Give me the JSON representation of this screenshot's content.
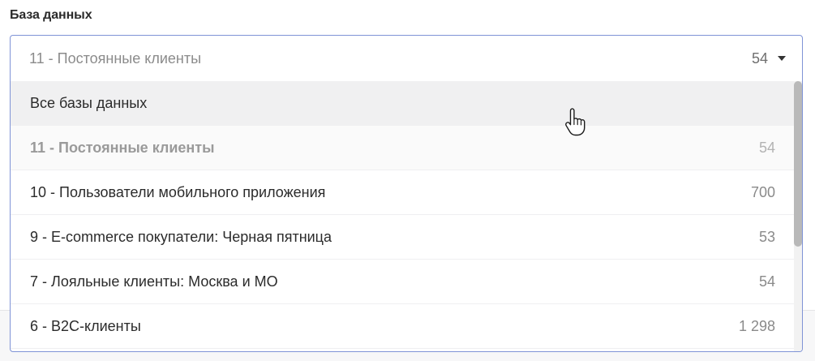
{
  "field": {
    "label": "База данных",
    "selected_value": "11 - Постоянные клиенты",
    "selected_count": "54"
  },
  "dropdown": {
    "options": [
      {
        "label": "Все базы данных",
        "count": "",
        "state": "hovered"
      },
      {
        "label": "11 - Постоянные клиенты",
        "count": "54",
        "state": "selected"
      },
      {
        "label": "10 - Пользователи мобильного приложения",
        "count": "700",
        "state": "normal"
      },
      {
        "label": "9 - E-commerce покупатели: Черная пятница",
        "count": "53",
        "state": "normal"
      },
      {
        "label": "7 - Лояльные клиенты: Москва и МО",
        "count": "54",
        "state": "normal"
      },
      {
        "label": "6 - B2C-клиенты",
        "count": "1 298",
        "state": "normal"
      }
    ]
  },
  "colors": {
    "border_focus": "#7f93d6",
    "hover_bg": "#f0f0f1",
    "text_primary": "#2b2b2b",
    "text_muted": "#8a8a8a"
  },
  "icons": {
    "caret": "caret-down-icon",
    "cursor": "hand-pointer-cursor-icon"
  }
}
